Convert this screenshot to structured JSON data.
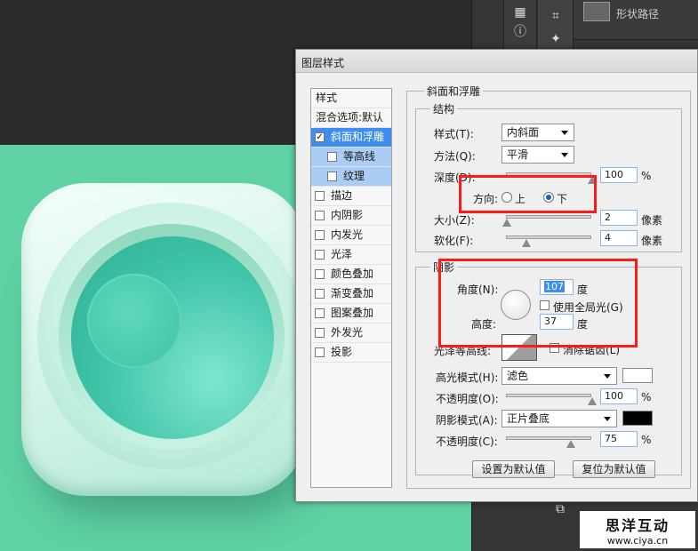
{
  "window": {
    "title": "图层样式"
  },
  "layers_panel": {
    "layer_name": "形状路径"
  },
  "watermark": {
    "brand": "思洋互动",
    "url": "www.ciya.cn"
  },
  "style_list": {
    "header": "样式",
    "blend_options": "混合选项:默认",
    "items": [
      {
        "label": "斜面和浮雕",
        "checked": true
      },
      {
        "label": "等高线",
        "checked": false
      },
      {
        "label": "纹理",
        "checked": false
      },
      {
        "label": "描边",
        "checked": false
      },
      {
        "label": "内阴影",
        "checked": false
      },
      {
        "label": "内发光",
        "checked": false
      },
      {
        "label": "光泽",
        "checked": false
      },
      {
        "label": "颜色叠加",
        "checked": false
      },
      {
        "label": "渐变叠加",
        "checked": false
      },
      {
        "label": "图案叠加",
        "checked": false
      },
      {
        "label": "外发光",
        "checked": false
      },
      {
        "label": "投影",
        "checked": false
      }
    ]
  },
  "bevel": {
    "section_title": "斜面和浮雕",
    "structure": {
      "title": "结构",
      "style_label": "样式(T):",
      "style_value": "内斜面",
      "technique_label": "方法(Q):",
      "technique_value": "平滑",
      "depth_label": "深度(D):",
      "depth_value": "100",
      "depth_unit": "%",
      "depth_level": 1.0,
      "direction_label": "方向:",
      "direction_up": "上",
      "direction_down": "下",
      "direction_selected": "下",
      "size_label": "大小(Z):",
      "size_value": "2",
      "size_unit": "像素",
      "soften_label": "软化(F):",
      "soften_value": "4",
      "soften_unit": "像素"
    },
    "shading": {
      "title": "阴影",
      "angle_label": "角度(N):",
      "angle_value": "107",
      "angle_unit": "度",
      "global_light_label": "使用全局光(G)",
      "altitude_label": "高度:",
      "altitude_value": "37",
      "altitude_unit": "度",
      "gloss_label": "光泽等高线:",
      "anti_alias_label": "消除锯齿(L)",
      "highlight_mode_label": "高光模式(H):",
      "highlight_mode_value": "滤色",
      "highlight_color": "#ffffff",
      "highlight_opacity_label": "不透明度(O):",
      "highlight_opacity_value": "100",
      "shadow_mode_label": "阴影模式(A):",
      "shadow_mode_value": "正片叠底",
      "shadow_color": "#000000",
      "shadow_opacity_label": "不透明度(C):",
      "shadow_opacity_value": "75",
      "percent_unit": "%"
    }
  },
  "buttons": {
    "set_default": "设置为默认值",
    "reset_default": "复位为默认值"
  }
}
